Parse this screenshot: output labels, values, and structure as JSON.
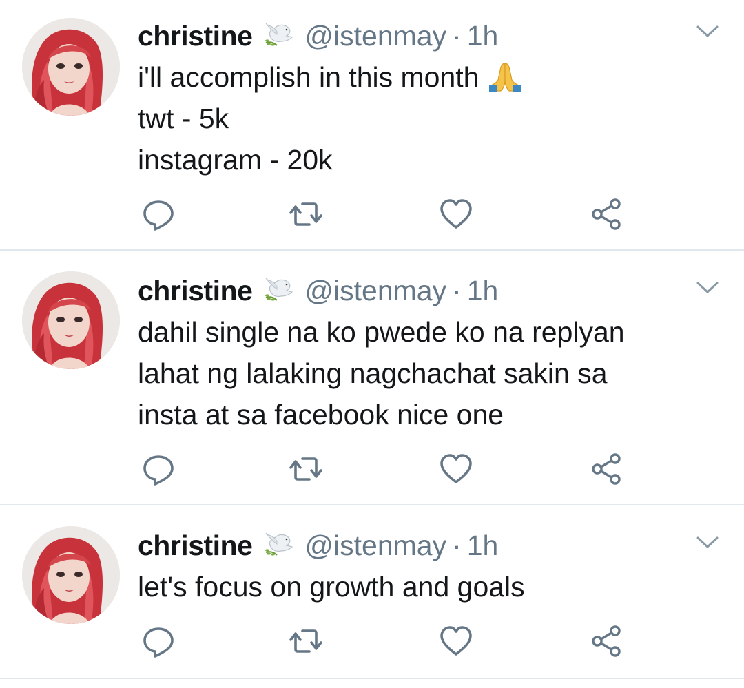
{
  "timeline": {
    "tweets": [
      {
        "name": "christine",
        "handle": "@istenmay",
        "separator": "·",
        "time": "1h",
        "lines": [
          "i'll accomplish in this month",
          "twt - 5k",
          "instagram - 20k"
        ],
        "emoji": "folded-hands-emoji",
        "badge_icon": "dove-icon"
      },
      {
        "name": "christine",
        "handle": "@istenmay",
        "separator": "·",
        "time": "1h",
        "lines": [
          "dahil single na ko pwede ko na replyan",
          "lahat ng lalaking nagchachat sakin sa",
          "insta at sa facebook nice one"
        ],
        "badge_icon": "dove-icon"
      },
      {
        "name": "christine",
        "handle": "@istenmay",
        "separator": "·",
        "time": "1h",
        "lines": [
          "let's focus on growth and goals"
        ],
        "badge_icon": "dove-icon"
      }
    ],
    "actions": [
      "reply-icon",
      "retweet-icon",
      "like-icon",
      "share-icon"
    ]
  },
  "colors": {
    "text": "#14171a",
    "secondary": "#657786",
    "divider": "#e1e8ed",
    "icon": "#657786",
    "avatar_hair": "#d94148"
  }
}
